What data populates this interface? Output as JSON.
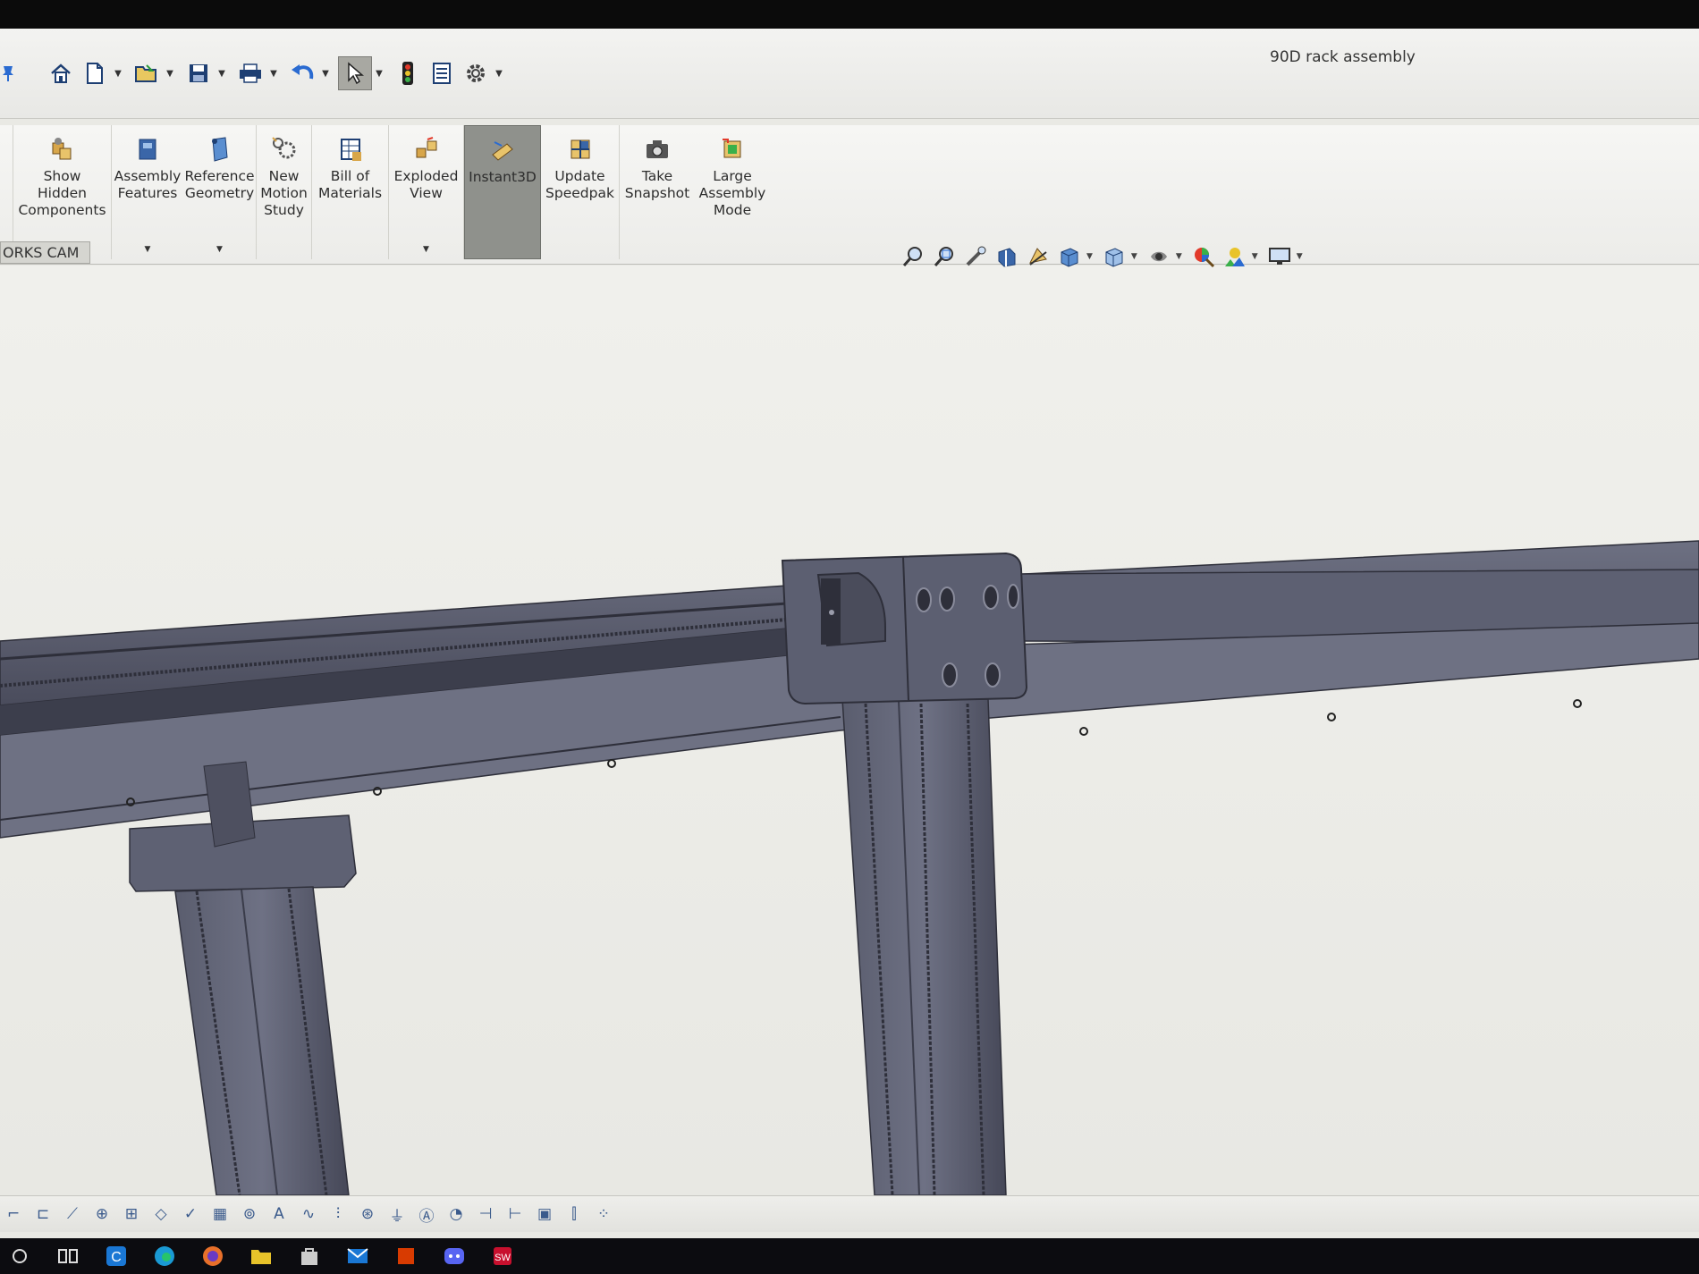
{
  "window": {
    "title": "90D rack assembly"
  },
  "quick_access": [
    {
      "name": "pin-icon"
    },
    {
      "name": "home-icon"
    },
    {
      "name": "new-document-icon"
    },
    {
      "name": "open-folder-icon"
    },
    {
      "name": "save-icon"
    },
    {
      "name": "print-icon"
    },
    {
      "name": "undo-icon"
    },
    {
      "name": "select-cursor-icon"
    },
    {
      "name": "rebuild-traffic-light-icon"
    },
    {
      "name": "file-properties-icon"
    },
    {
      "name": "options-gear-icon"
    }
  ],
  "command_manager": {
    "items": [
      {
        "id": "show-hidden",
        "label": "Show\nHidden\nComponents",
        "has_dropdown": false
      },
      {
        "id": "assembly-features",
        "label": "Assembly\nFeatures",
        "has_dropdown": true
      },
      {
        "id": "reference-geometry",
        "label": "Reference\nGeometry",
        "has_dropdown": true
      },
      {
        "id": "new-motion-study",
        "label": "New\nMotion\nStudy",
        "has_dropdown": false
      },
      {
        "id": "bill-of-materials",
        "label": "Bill of\nMaterials",
        "has_dropdown": false
      },
      {
        "id": "exploded-view",
        "label": "Exploded\nView",
        "has_dropdown": true
      },
      {
        "id": "instant3d",
        "label": "Instant3D",
        "has_dropdown": false,
        "active": true
      },
      {
        "id": "update-speedpak",
        "label": "Update\nSpeedpak",
        "has_dropdown": false
      },
      {
        "id": "take-snapshot",
        "label": "Take\nSnapshot",
        "has_dropdown": false
      },
      {
        "id": "large-assembly-mode",
        "label": "Large\nAssembly\nMode",
        "has_dropdown": false
      }
    ]
  },
  "tabs": {
    "visible_tab": "ORKS CAM"
  },
  "heads_up_toolbar": [
    "zoom-to-fit-icon",
    "zoom-to-area-icon",
    "previous-view-icon",
    "section-view-icon",
    "dynamic-annotation-icon",
    "view-orientation-icon",
    "display-style-icon",
    "hide-show-items-icon",
    "edit-appearance-icon",
    "apply-scene-icon",
    "view-settings-monitor-icon"
  ],
  "colors": {
    "accent": "#2a4f8a",
    "active_button": "#8f918c",
    "model_body": "#5d6072",
    "model_dark": "#3a3c4a",
    "model_light": "#777a8c",
    "background": "#e9e9e4"
  }
}
